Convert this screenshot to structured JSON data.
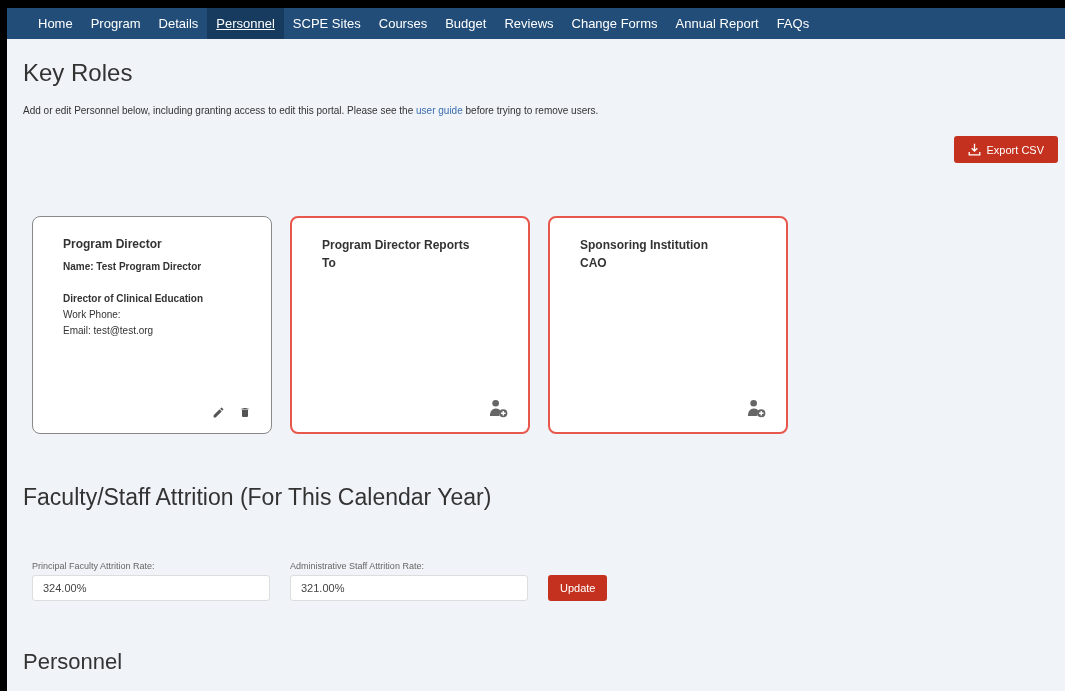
{
  "nav": [
    {
      "label": "Home",
      "selected": false
    },
    {
      "label": "Program",
      "selected": false
    },
    {
      "label": "Details",
      "selected": false
    },
    {
      "label": "Personnel",
      "selected": true
    },
    {
      "label": "SCPE Sites",
      "selected": false
    },
    {
      "label": "Courses",
      "selected": false
    },
    {
      "label": "Budget",
      "selected": false
    },
    {
      "label": "Reviews",
      "selected": false
    },
    {
      "label": "Change Forms",
      "selected": false
    },
    {
      "label": "Annual Report",
      "selected": false
    },
    {
      "label": "FAQs",
      "selected": false
    }
  ],
  "key_roles": {
    "title": "Key Roles",
    "intro_before": "Add or edit Personnel below, including granting access to edit this portal. Please see the",
    "intro_link": "user guide",
    "intro_after": "before trying to remove users.",
    "export_button": "Export CSV",
    "cards": [
      {
        "kind": "filled",
        "title": "Program Director",
        "name": "Name: Test Program Director",
        "position": "Director of Clinical Education",
        "phone": "Work Phone:",
        "email": "Email: test@test.org"
      },
      {
        "kind": "empty",
        "title": "Program Director Reports To"
      },
      {
        "kind": "empty",
        "title": "Sponsoring Institution CAO"
      }
    ]
  },
  "attrition": {
    "title": "Faculty/Staff Attrition (For This Calendar Year)",
    "fields": [
      {
        "label": "Principal Faculty Attrition Rate:",
        "value": "324.00%"
      },
      {
        "label": "Administrative Staff Attrition Rate:",
        "value": "321.00%"
      }
    ],
    "update_button": "Update"
  },
  "personnel": {
    "title": "Personnel"
  }
}
